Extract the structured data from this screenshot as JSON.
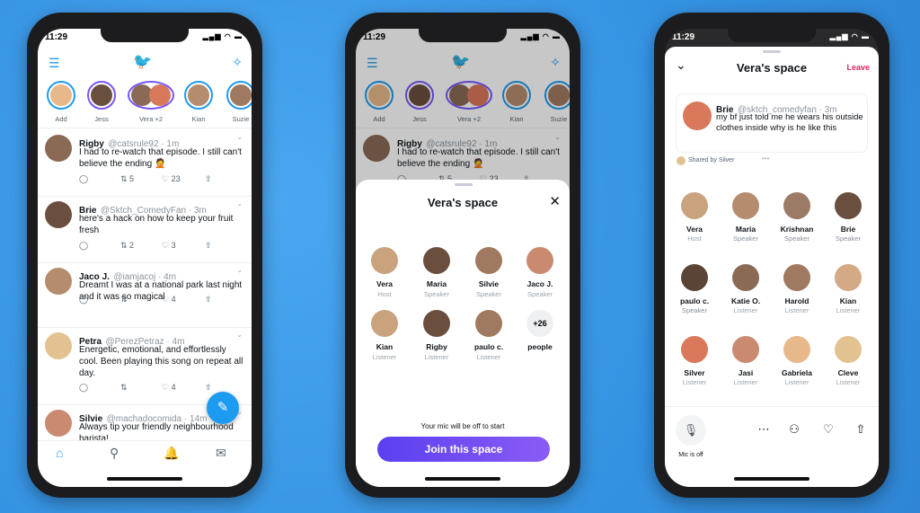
{
  "status_time": "11:29",
  "status_icons": "▂▄▆ ◠ ▬",
  "colors": {
    "twitter_blue": "#1d9bf0",
    "spaces_purple": "#7856ff",
    "leave_red": "#e0245e"
  },
  "feed": {
    "stories": [
      {
        "label": "Add"
      },
      {
        "label": "Jess"
      },
      {
        "label": "Vera +2"
      },
      {
        "label": "Kian"
      },
      {
        "label": "Suzie"
      }
    ],
    "tweets": [
      {
        "name": "Rigby",
        "handle": "@catsrule92 · 1m",
        "text": "I had to re-watch that episode. I still can't believe the ending 🤦",
        "retweets": "5",
        "likes": "23"
      },
      {
        "name": "Brie",
        "handle": "@Sktch_ComedyFan · 3m",
        "text": "here's a hack on how to keep your fruit fresh",
        "retweets": "2",
        "likes": "3"
      },
      {
        "name": "Jaco J.",
        "handle": "@iamjacoj · 4m",
        "text": "Dreamt I was at a national park last night and it was so magical",
        "retweets": "",
        "likes": "4"
      },
      {
        "name": "Petra",
        "handle": "@PerezPetraz · 4m",
        "text": "Energetic, emotional, and effortlessly cool. Been playing this song on repeat all day.",
        "retweets": "",
        "likes": "4"
      },
      {
        "name": "Silvie",
        "handle": "@machadocomida · 14m",
        "text": "Always tip your friendly neighbourhood barista!",
        "retweets": "",
        "likes": ""
      }
    ]
  },
  "join_sheet": {
    "title": "Vera's space",
    "participants": [
      {
        "name": "Vera",
        "role": "Host"
      },
      {
        "name": "Maria",
        "role": "Speaker"
      },
      {
        "name": "Silvie",
        "role": "Speaker"
      },
      {
        "name": "Jaco J.",
        "role": "Speaker"
      },
      {
        "name": "Kian",
        "role": "Listener"
      },
      {
        "name": "Rigby",
        "role": "Listener"
      },
      {
        "name": "paulo c.",
        "role": "Listener"
      }
    ],
    "more_count": "+26",
    "more_label": "people",
    "mic_note": "Your mic will be off to start",
    "join_label": "Join this space"
  },
  "space": {
    "title": "Vera's space",
    "leave_label": "Leave",
    "pinned_tweet": {
      "name": "Brie",
      "handle": "@sktch_comedyfan · 3m",
      "text": "my bf just told me he wears his outside clothes inside why is he like this"
    },
    "shared_by": "Shared by Silver",
    "participants": [
      {
        "name": "Vera",
        "role": "Host"
      },
      {
        "name": "Maria",
        "role": "Speaker"
      },
      {
        "name": "Krishnan",
        "role": "Speaker"
      },
      {
        "name": "Brie",
        "role": "Speaker"
      },
      {
        "name": "paulo c.",
        "role": "Speaker"
      },
      {
        "name": "Katie O.",
        "role": "Listener"
      },
      {
        "name": "Harold",
        "role": "Listener"
      },
      {
        "name": "Kian",
        "role": "Listener"
      },
      {
        "name": "Silver",
        "role": "Listener"
      },
      {
        "name": "Jasi",
        "role": "Listener"
      },
      {
        "name": "Gabriela",
        "role": "Listener"
      },
      {
        "name": "Cleve",
        "role": "Listener"
      }
    ],
    "mic_label": "Mic is off"
  }
}
